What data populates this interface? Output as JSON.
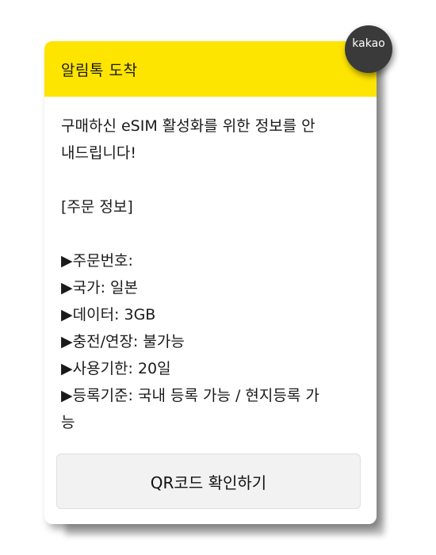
{
  "header": {
    "title": "알림톡 도착"
  },
  "badge": {
    "label": "kakao"
  },
  "message": {
    "intro_line1": "구매하신 eSIM 활성화를 위한 정보를 안",
    "intro_line2": "내드립니다!",
    "section_title": "[주문 정보]",
    "items": [
      "▶주문번호:",
      "▶국가: 일본",
      "▶데이터: 3GB",
      "▶충전/연장: 불가능",
      "▶사용기한: 20일",
      "▶등록기준: 국내 등록 가능 / 현지등록 가",
      "능"
    ]
  },
  "cta": {
    "label": "QR코드 확인하기"
  },
  "colors": {
    "header_bg": "#FEE500",
    "badge_bg": "#3a3a3a",
    "button_bg": "#f2f2f2"
  }
}
